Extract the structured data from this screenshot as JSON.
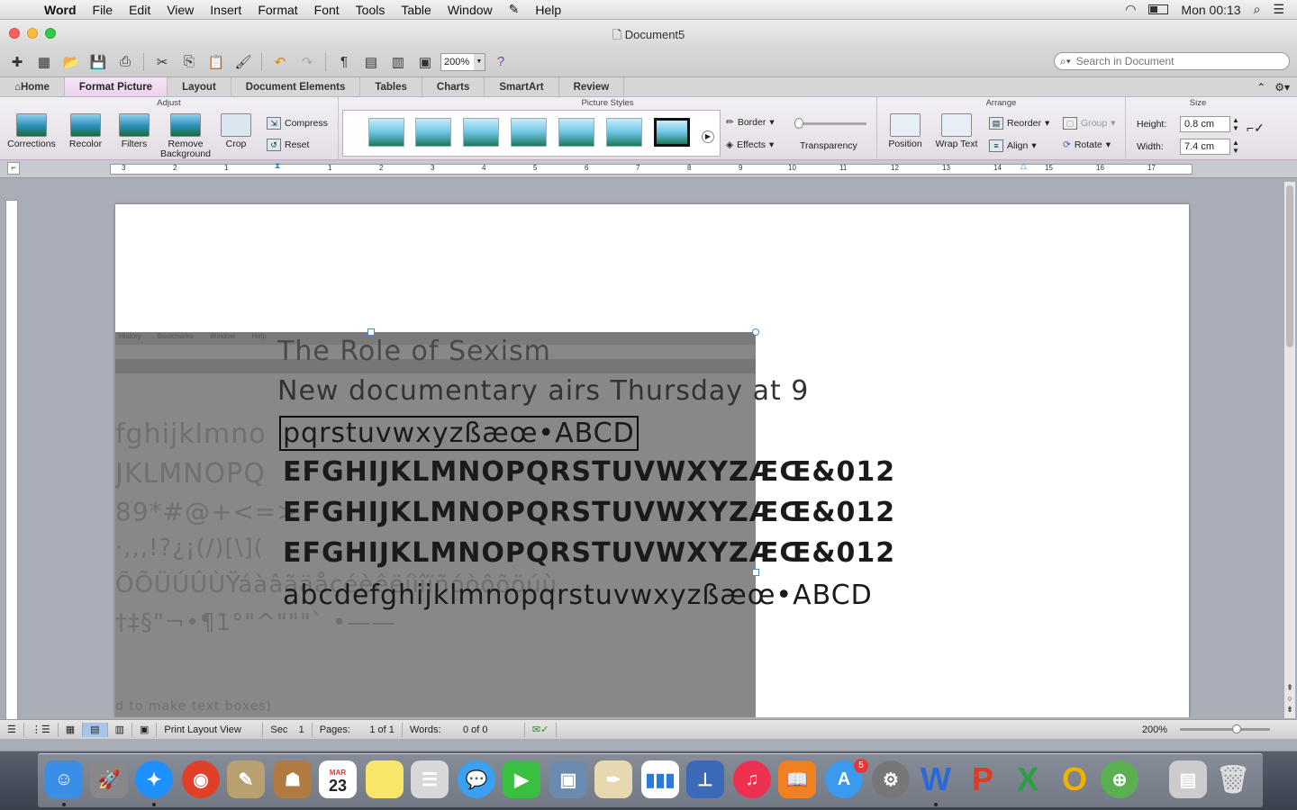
{
  "menubar": {
    "app": "Word",
    "items": [
      "File",
      "Edit",
      "View",
      "Insert",
      "Format",
      "Font",
      "Tools",
      "Table",
      "Window",
      "Help"
    ],
    "clock": "Mon 00:13"
  },
  "window": {
    "title": "Document5"
  },
  "toolbar": {
    "zoom": "200%",
    "search_placeholder": "Search in Document"
  },
  "tabs": [
    "Home",
    "Format Picture",
    "Layout",
    "Document Elements",
    "Tables",
    "Charts",
    "SmartArt",
    "Review"
  ],
  "ribbon": {
    "adjust": {
      "title": "Adjust",
      "corrections": "Corrections",
      "recolor": "Recolor",
      "filters": "Filters",
      "remove_bg": "Remove Background",
      "crop": "Crop",
      "compress": "Compress",
      "reset": "Reset"
    },
    "styles": {
      "title": "Picture Styles",
      "border": "Border",
      "effects": "Effects",
      "transparency": "Transparency"
    },
    "arrange": {
      "title": "Arrange",
      "position": "Position",
      "wrap": "Wrap Text",
      "reorder": "Reorder",
      "align": "Align",
      "group": "Group",
      "rotate": "Rotate"
    },
    "size": {
      "title": "Size",
      "height_label": "Height:",
      "height": "0.8 cm",
      "width_label": "Width:",
      "width": "7.4 cm"
    }
  },
  "ruler": {
    "numbers": [
      "3",
      "2",
      "1",
      "1",
      "2",
      "3",
      "4",
      "5",
      "6",
      "7",
      "8",
      "9",
      "10",
      "11",
      "12",
      "13",
      "14",
      "15",
      "16",
      "17"
    ]
  },
  "document": {
    "lines": [
      "The Role of Sexism",
      "New documentary airs Thursday at 9",
      "pqrstuvwxyzßæœ•ABCD",
      "EFGHIJKLMNOPQRSTUVWXYZÆŒ&012",
      "EFGHIJKLMNOPQRSTUVWXYZÆŒ&012",
      "EFGHIJKLMNOPQRSTUVWXYZÆŒ&012",
      "abcdefghijklmnopqrstuvwxyzßæœ•ABCD"
    ],
    "left_fragments": [
      "fghijklmno",
      "JKLMNOPQ",
      "89*#@+<=>",
      "·,,,!?¿¡(/)[\\](",
      "ÕÕÜÚÛÙŸáàâãäåçéèêëíìîïñóòôõöúù",
      "†‡§\"¬•¶1°\"^\"\"\"`  •——"
    ],
    "bottom_fragment": "d to make text boxes)",
    "picture_top": [
      "History",
      "Bookmarks",
      "Window",
      "Help"
    ]
  },
  "status": {
    "view": "Print Layout View",
    "sec_label": "Sec",
    "sec": "1",
    "pages_label": "Pages:",
    "pages": "1 of 1",
    "words_label": "Words:",
    "words": "0 of 0",
    "zoom": "200%"
  },
  "dock": {
    "calendar_month": "MAR",
    "calendar_day": "23",
    "appstore_badge": "5"
  }
}
